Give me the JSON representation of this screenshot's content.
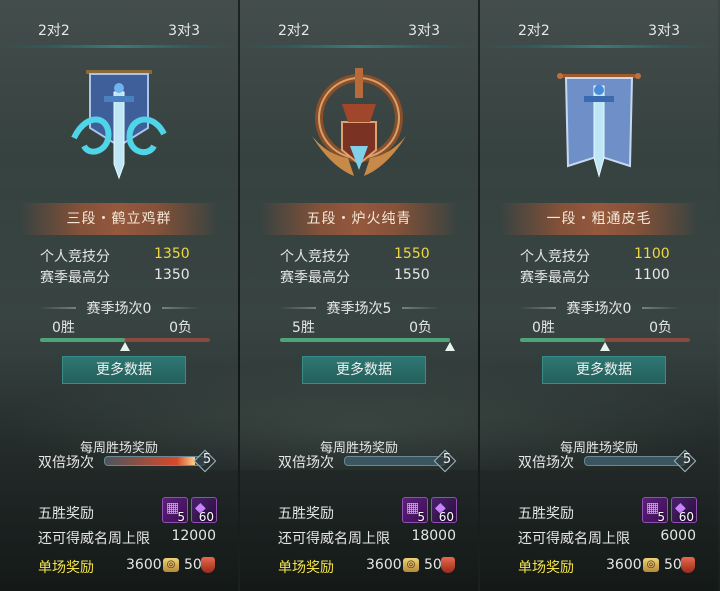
{
  "tabs": {
    "left": "2对2",
    "right": "3对3"
  },
  "labels": {
    "personal_score": "个人竞技分",
    "season_high": "赛季最高分",
    "more_data": "更多数据",
    "weekly_reward": "每周胜场奖励",
    "double_games": "双倍场次",
    "five_win_reward": "五胜奖励",
    "weekly_cap": "还可得威名周上限",
    "per_match_reward": "单场奖励"
  },
  "panels": [
    {
      "rank": "三段・鹤立鸡群",
      "emblem_icon": "blue-dragon-sword-banner-icon",
      "personal_score": "1350",
      "season_high": "1350",
      "season_games": "赛季场次0",
      "wins": "0胜",
      "losses": "0负",
      "win_ratio": 0.5,
      "double_count": "5",
      "double_fill": 0.9,
      "chest_count": "5",
      "gem_count": "60",
      "weekly_cap_value": "12000",
      "per_match_coin": "3600",
      "per_match_honor": "50"
    },
    {
      "rank": "五段・炉火纯青",
      "emblem_icon": "bronze-winged-sword-shield-icon",
      "personal_score": "1550",
      "season_high": "1550",
      "season_games": "赛季场次5",
      "wins": "5胜",
      "losses": "0负",
      "win_ratio": 1.0,
      "double_count": "5",
      "double_fill": 0.0,
      "chest_count": "5",
      "gem_count": "60",
      "weekly_cap_value": "18000",
      "per_match_coin": "3600",
      "per_match_honor": "50"
    },
    {
      "rank": "一段・粗通皮毛",
      "emblem_icon": "blue-sword-banner-icon",
      "personal_score": "1100",
      "season_high": "1100",
      "season_games": "赛季场次0",
      "wins": "0胜",
      "losses": "0负",
      "win_ratio": 0.5,
      "double_count": "5",
      "double_fill": 0.0,
      "chest_count": "5",
      "gem_count": "60",
      "weekly_cap_value": "6000",
      "per_match_coin": "3600",
      "per_match_honor": "50"
    }
  ],
  "colors": {
    "score_gold": "#f0d743",
    "reward_yellow": "#f3e24a",
    "button_teal": "#2e7672",
    "win_green": "#4ea37b",
    "loss_red": "#884b3e"
  }
}
